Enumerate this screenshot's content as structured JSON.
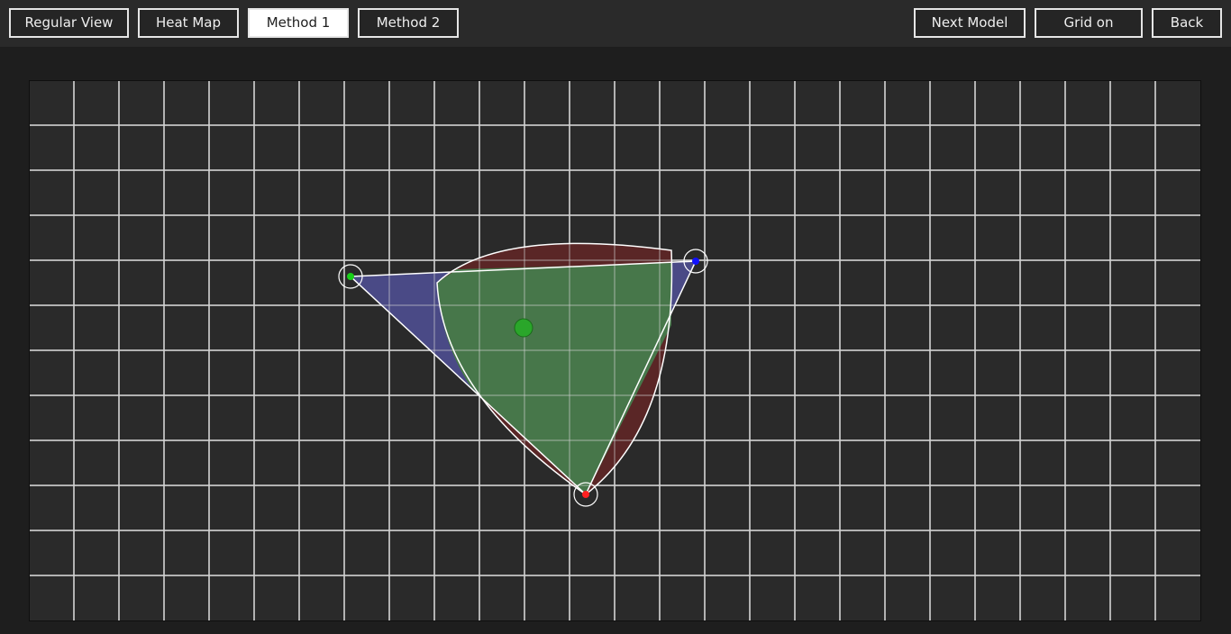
{
  "toolbar": {
    "left_buttons": [
      "Regular View",
      "Heat Map",
      "Method 1",
      "Method 2"
    ],
    "right_buttons": [
      "Next Model",
      "Grid on",
      "Back"
    ],
    "active_button": "Method 1"
  },
  "canvas": {
    "grid": true,
    "colors": {
      "background": "#2a2a2a",
      "grid_line": "#d2d2d2",
      "method1_fill": "#4a4a86",
      "method2_fill": "#5a2626",
      "overlap_fill": "#47774a",
      "outline": "#ffffff",
      "vertex_green": "#18d018",
      "vertex_blue": "#1010ff",
      "vertex_red": "#ff2020",
      "centroid": "#2aa62a"
    },
    "icons": [
      "vertex-handle-green-icon",
      "vertex-handle-blue-icon",
      "vertex-handle-red-icon",
      "centroid-icon"
    ]
  }
}
